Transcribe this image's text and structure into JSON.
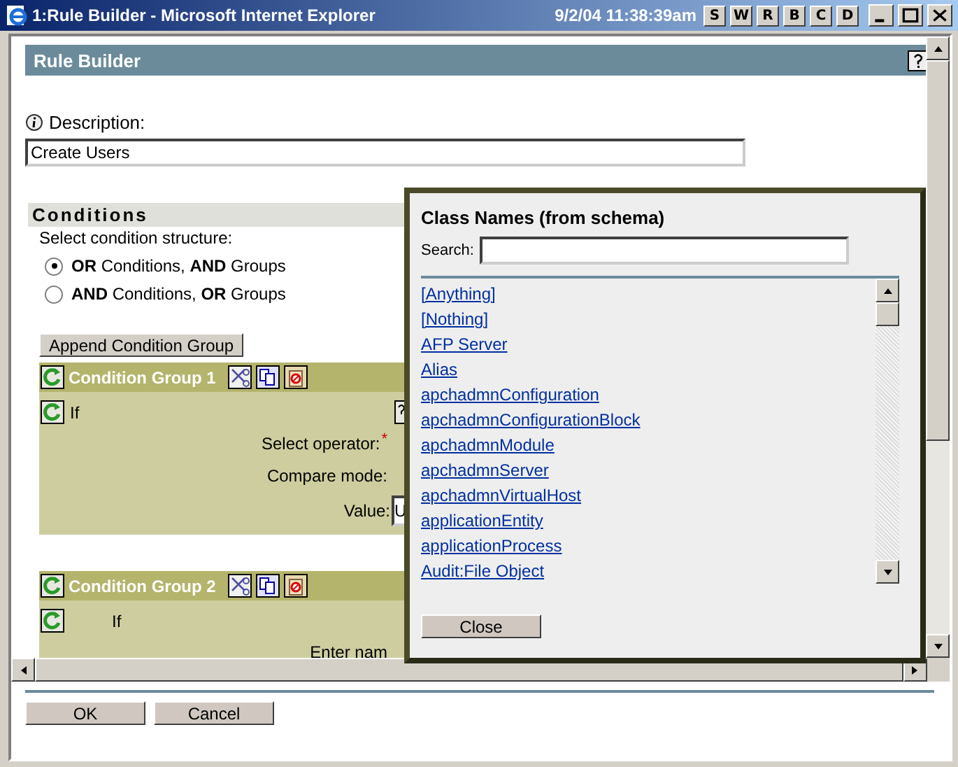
{
  "window": {
    "title": "1:Rule Builder - Microsoft Internet Explorer",
    "clock": "9/2/04 11:38:39am",
    "shortcut_keys": [
      "S",
      "W",
      "R",
      "B",
      "C",
      "D"
    ]
  },
  "page": {
    "title": "Rule Builder",
    "description_label": "Description:",
    "description_value": "Create Users"
  },
  "conditions": {
    "title": "Conditions",
    "structure_label": "Select condition structure:",
    "options": [
      {
        "label": "**OR** Conditions, **AND** Groups",
        "selected": true
      },
      {
        "label": "**AND** Conditions, **OR** Groups",
        "selected": false
      }
    ],
    "append_button": "Append Condition Group",
    "groups": [
      {
        "title": "Condition Group 1",
        "if_label": "If",
        "fields": [
          {
            "label": "Select operator:",
            "marker": "*"
          },
          {
            "label": "Compare mode:"
          },
          {
            "label": "Value:",
            "value": "U"
          }
        ]
      },
      {
        "title": "Condition Group 2",
        "if_label": "If",
        "fields": [
          {
            "label": "Enter nam"
          }
        ]
      }
    ]
  },
  "popup": {
    "title": "Class Names (from schema)",
    "search_label": "Search:",
    "items": [
      "[Anything]",
      "[Nothing]",
      "AFP Server",
      "Alias",
      "apchadmnConfiguration",
      "apchadmnConfigurationBlock",
      "apchadmnModule",
      "apchadmnServer",
      "apchadmnVirtualHost",
      "applicationEntity",
      "applicationProcess",
      "Audit:File Object"
    ],
    "close_button": "Close"
  },
  "buttons": [
    "OK",
    "Cancel"
  ]
}
